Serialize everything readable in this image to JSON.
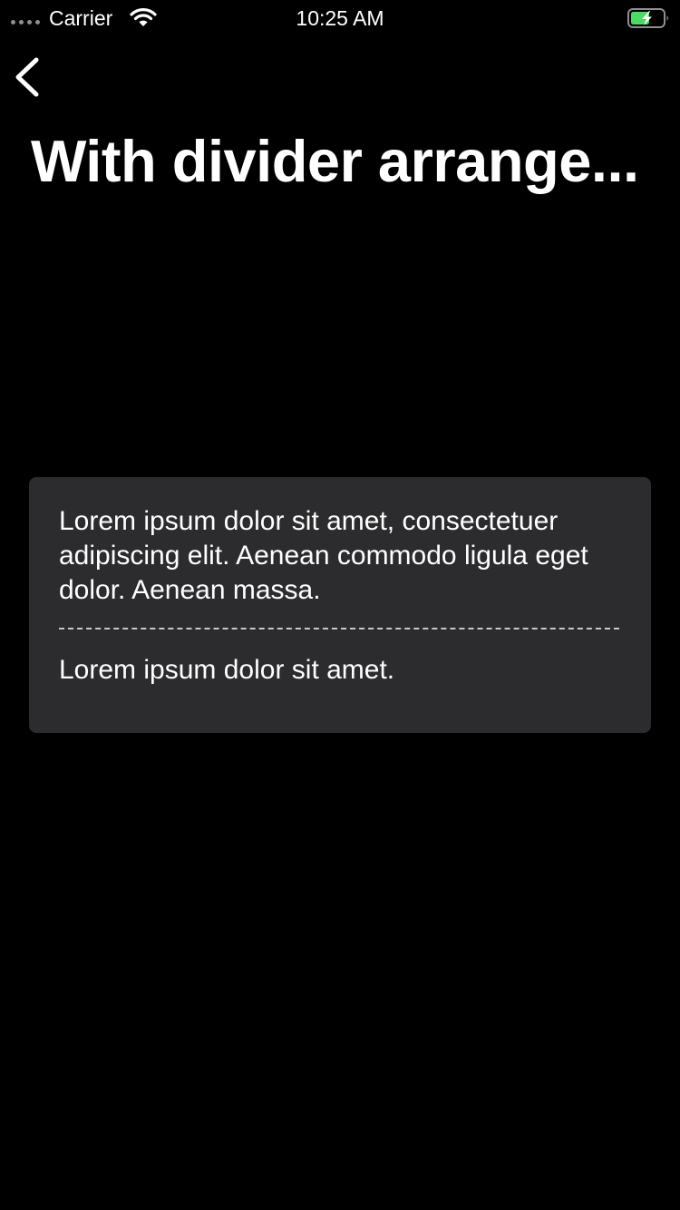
{
  "status_bar": {
    "carrier": "Carrier",
    "time": "10:25 AM",
    "icons": [
      "signal-dots-icon",
      "wifi-icon",
      "battery-charging-icon"
    ],
    "battery_color": "#4cd964"
  },
  "nav": {
    "back_icon": "chevron-left-icon",
    "title": "With divider arrange..."
  },
  "card": {
    "primary_text": "Lorem ipsum dolor sit amet, consectetuer adipiscing elit. Aenean commodo ligula eget dolor. Aenean massa.",
    "secondary_text": "Lorem ipsum dolor sit amet.",
    "divider_style": "dashed",
    "background_color": "#2c2c2e"
  },
  "theme": {
    "background": "#000000",
    "text": "#ffffff"
  }
}
